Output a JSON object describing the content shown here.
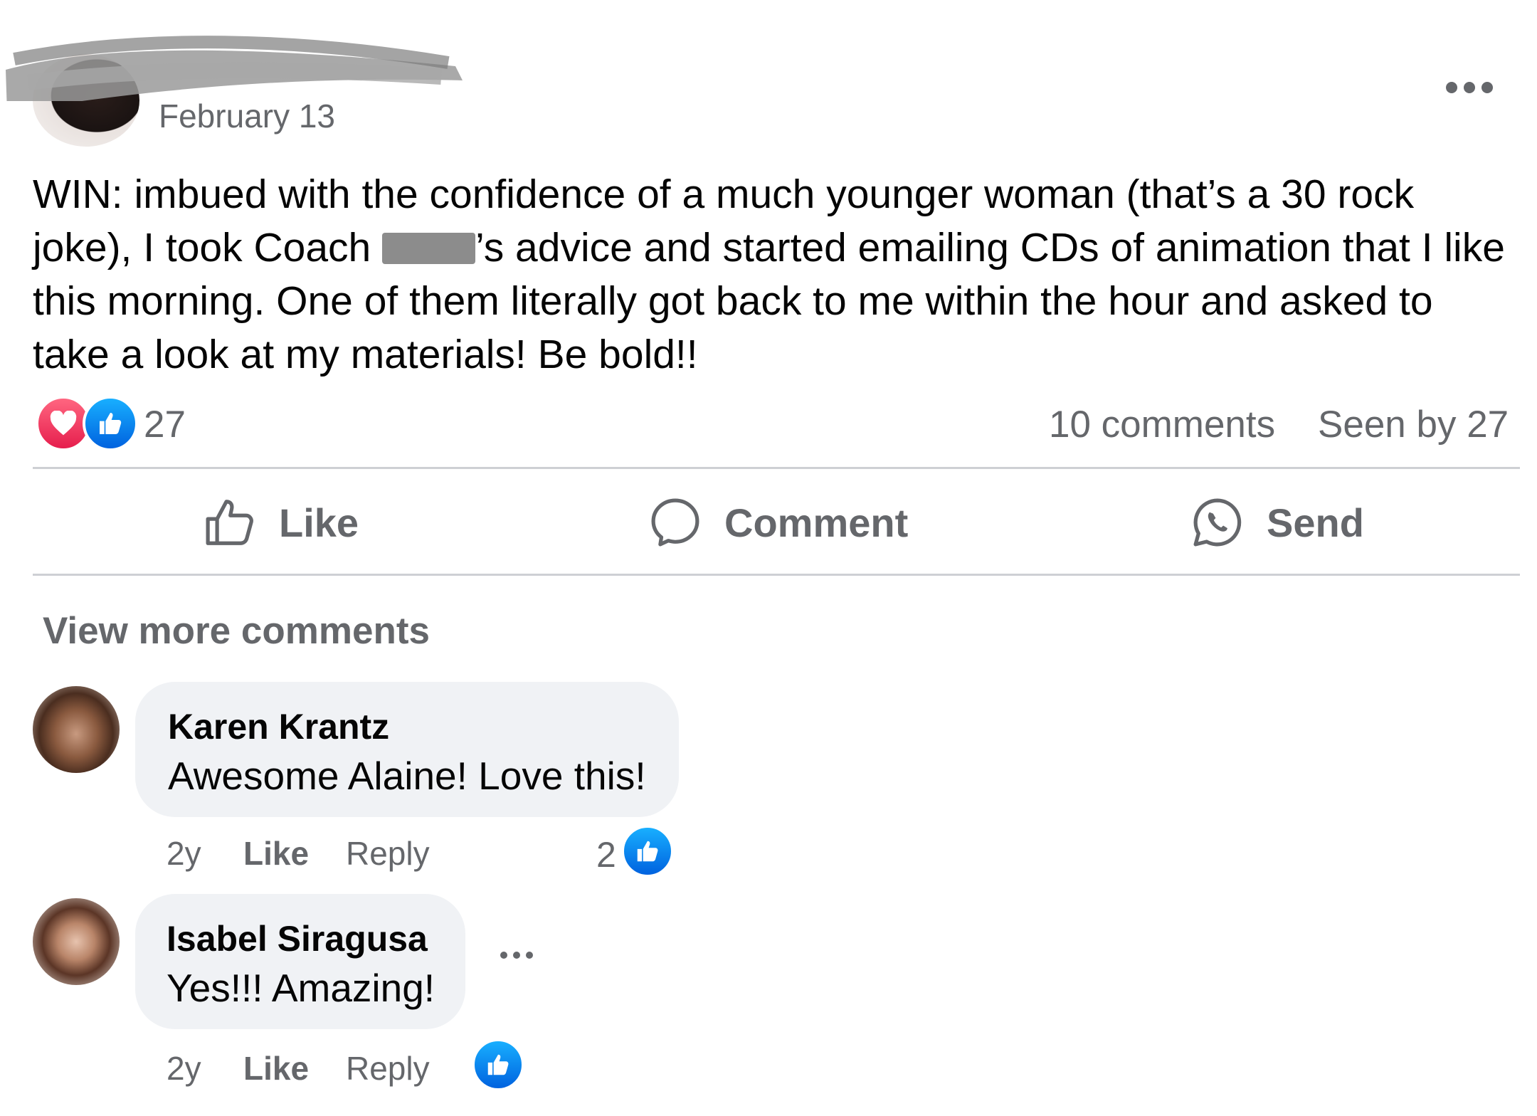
{
  "post": {
    "date": "February 13",
    "body_before_redaction": "WIN: imbued with the confidence of a much younger woman (that’s a 30 rock joke), I took Coach ",
    "body_after_redaction": "’s advice and started emailing CDs of animation that I like this morning. One of them literally got back to me within the hour and asked to take a look at my materials! Be bold!!",
    "reaction_count": "27",
    "comments_count": "10 comments",
    "seen_by": "Seen by 27",
    "reaction_icons": [
      "heart-icon",
      "thumbs-up-icon"
    ],
    "colors": {
      "heart": "#e61e4d",
      "like": "#0866ff",
      "muted_text": "#65676b",
      "bubble": "#f0f2f5"
    }
  },
  "actions": {
    "like_label": "Like",
    "comment_label": "Comment",
    "send_label": "Send"
  },
  "view_more_label": "View more comments",
  "comments": [
    {
      "name": "Karen Krantz",
      "text": "Awesome Alaine! Love this!",
      "age": "2y",
      "like_label": "Like",
      "reply_label": "Reply",
      "reaction_count": "2"
    },
    {
      "name": "Isabel Siragusa",
      "text": "Yes!!! Amazing!",
      "age": "2y",
      "like_label": "Like",
      "reply_label": "Reply",
      "reaction_count": ""
    }
  ]
}
